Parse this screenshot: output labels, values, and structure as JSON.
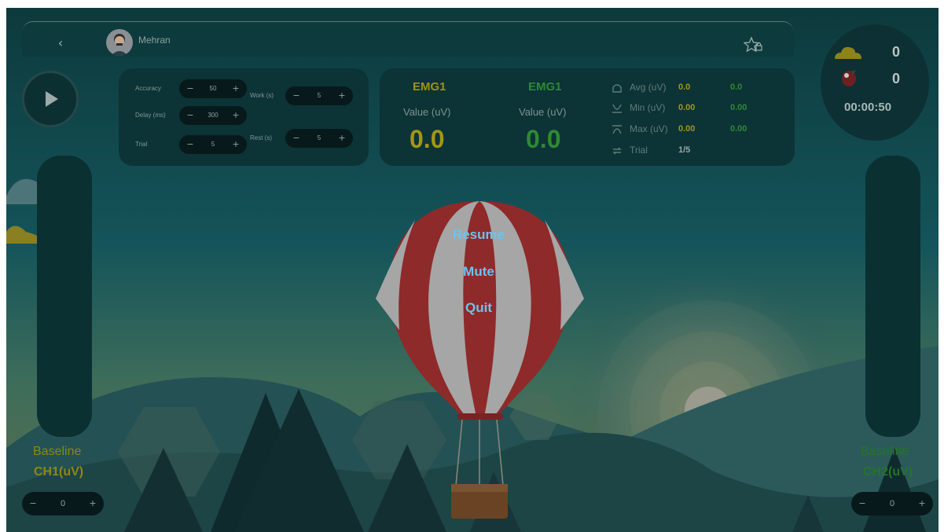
{
  "user": {
    "name": "Mehran"
  },
  "icons": {
    "back": "chevron-left-icon",
    "star": "star-lock-icon",
    "play": "play-icon",
    "cloud": "cloud-icon",
    "bird": "bird-icon",
    "avg": "avg-icon",
    "min": "min-icon",
    "max": "max-icon",
    "trial": "repeat-icon"
  },
  "params": {
    "accuracy": {
      "label": "Accuracy",
      "value": "50"
    },
    "delay": {
      "label": "Delay (ms)",
      "value": "300"
    },
    "trial": {
      "label": "Trial",
      "value": "5"
    },
    "work": {
      "label": "Work (s)",
      "value": "5"
    },
    "rest": {
      "label": "Rest (s)",
      "value": "5"
    }
  },
  "emg": [
    {
      "title": "EMG1",
      "subtitle": "Value (uV)",
      "value": "0.0",
      "color": "#a39614"
    },
    {
      "title": "EMG1",
      "subtitle": "Value (uV)",
      "value": "0.0",
      "color": "#2e8a33"
    }
  ],
  "stats": {
    "avg": {
      "label": "Avg (uV)",
      "ch1": "0.0",
      "ch2": "0.0"
    },
    "min": {
      "label": "Min (uV)",
      "ch1": "0.00",
      "ch2": "0.00"
    },
    "max": {
      "label": "Max (uV)",
      "ch1": "0.00",
      "ch2": "0.00"
    },
    "trial": {
      "label": "Trial",
      "value": "1/5"
    }
  },
  "score": {
    "clouds": "0",
    "birds": "0",
    "timer": "00:00:50"
  },
  "baseline": {
    "ch1": {
      "label": "Baseline",
      "channel": "CH1(uV)",
      "value": "0",
      "color": "#8e8713"
    },
    "ch2": {
      "label": "Baseline",
      "channel": "CH2(uV)",
      "value": "0",
      "color": "#237428"
    }
  },
  "menu": {
    "resume": "Resume",
    "mute": "Mute",
    "quit": "Quit"
  },
  "colors": {
    "ch1": "#c9b81a",
    "ch2": "#3aa043",
    "menu": "#67c6f0"
  }
}
